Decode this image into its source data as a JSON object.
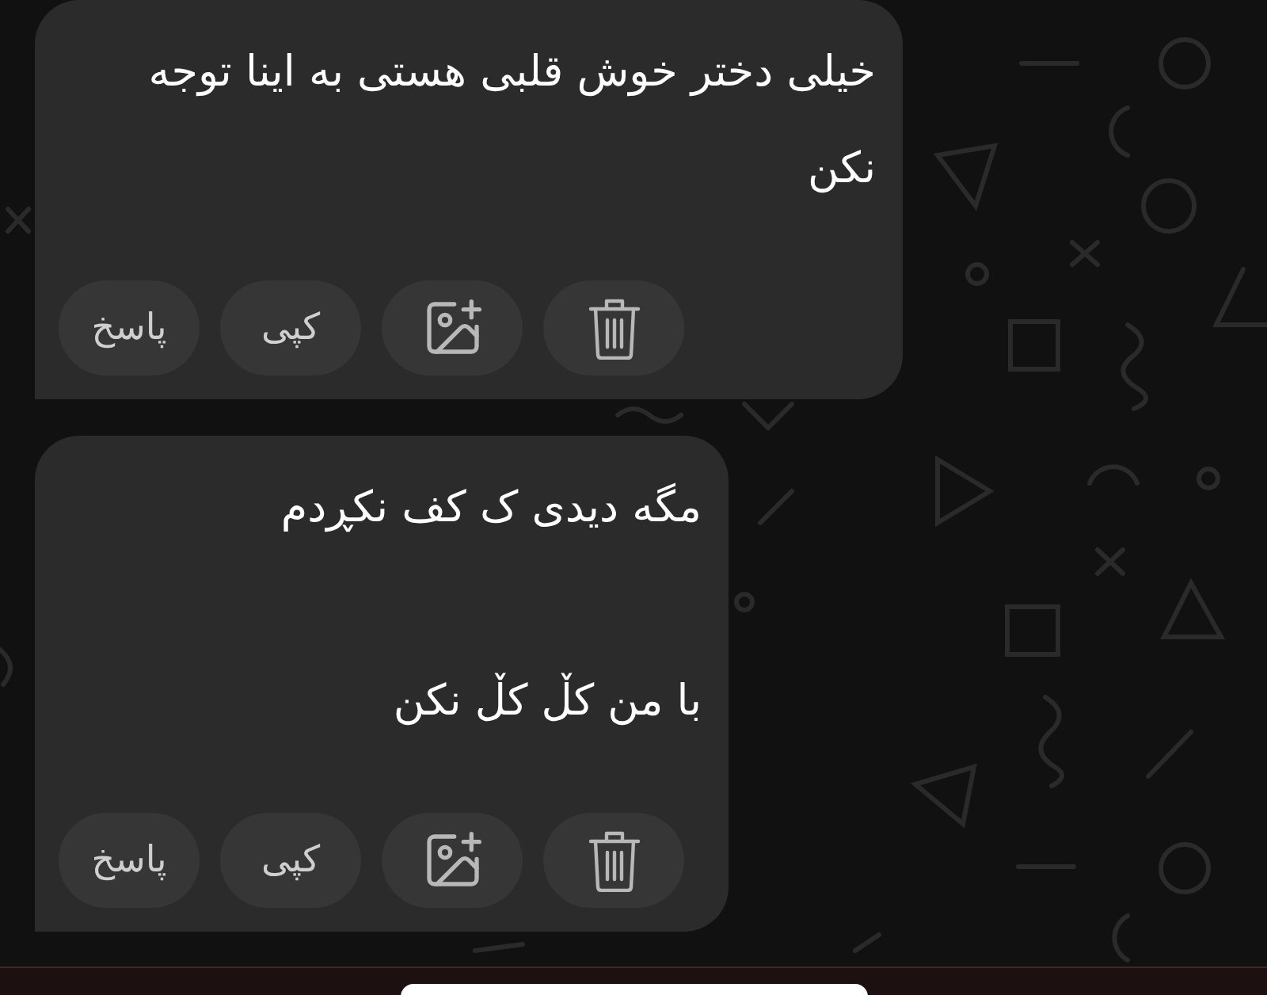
{
  "messages": [
    {
      "text": "خیلی دختر خوش قلبی هستی به اینا توجه نکن",
      "actions": [
        "کپی",
        "پاسخ"
      ]
    },
    {
      "text": "مگه دیدی ک کف نکڕدم\n\nبا من کڵ کڵ نکن",
      "actions": [
        "کپی",
        "پاسخ"
      ]
    }
  ]
}
